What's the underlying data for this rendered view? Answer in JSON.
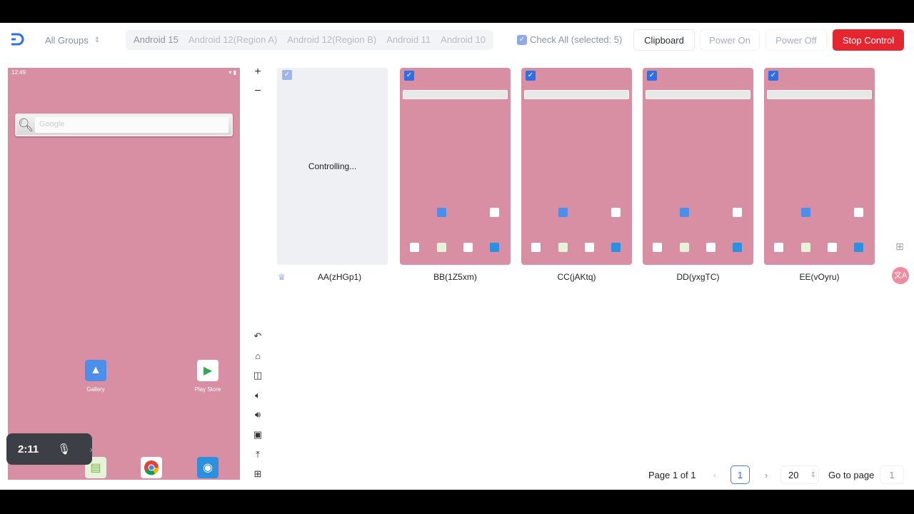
{
  "header": {
    "groups_label": "All Groups",
    "tabs": [
      "Android 15",
      "Android 12(Region A)",
      "Android 12(Region B)",
      "Android 11",
      "Android 10"
    ],
    "check_all_label": "Check All (selected: 5)",
    "clipboard_label": "Clipboard",
    "power_on_label": "Power On",
    "power_off_label": "Power Off",
    "stop_control_label": "Stop Control"
  },
  "main_device": {
    "status_time": "12:49",
    "search_placeholder": "Google",
    "apps": [
      {
        "name": "Gallery",
        "icon": "gallery-icon"
      },
      {
        "name": "Play Store",
        "icon": "play-store-icon"
      }
    ],
    "dock": [
      "phone-icon",
      "messages-icon",
      "chrome-icon",
      "camera-icon"
    ],
    "timer": "2:11"
  },
  "devices": [
    {
      "name": "AA(zHGp1)",
      "status": "Controlling...",
      "checked": true,
      "controlling": true
    },
    {
      "name": "BB(1Z5xm)",
      "checked": true
    },
    {
      "name": "CC(jAKtq)",
      "checked": true
    },
    {
      "name": "DD(yxgTC)",
      "checked": true
    },
    {
      "name": "EE(vOyru)",
      "checked": true
    }
  ],
  "zoom": {
    "plus": "+",
    "minus": "−"
  },
  "pagination": {
    "info": "Page 1 of 1",
    "current": "1",
    "page_size": "20",
    "goto_label": "Go to page",
    "goto_value": "1"
  },
  "colors": {
    "accent": "#2f6fe3",
    "danger": "#e5252f",
    "screen_bg": "#d88ea3"
  }
}
